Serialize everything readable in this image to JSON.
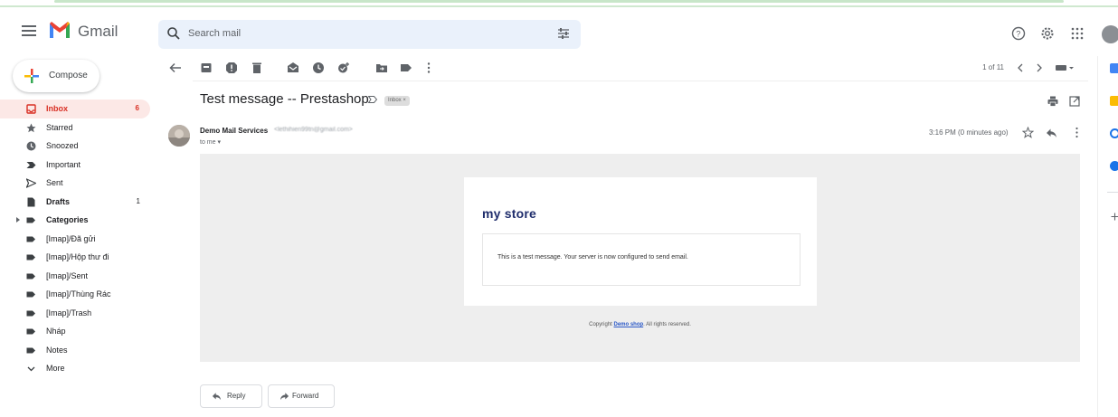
{
  "app": {
    "name": "Gmail"
  },
  "search": {
    "placeholder": "Search mail"
  },
  "compose": {
    "label": "Compose"
  },
  "sidebar": {
    "items": [
      {
        "label": "Inbox",
        "count": "6",
        "icon": "inbox-icon"
      },
      {
        "label": "Starred",
        "count": "",
        "icon": "star-icon"
      },
      {
        "label": "Snoozed",
        "count": "",
        "icon": "clock-icon"
      },
      {
        "label": "Important",
        "count": "",
        "icon": "important-icon"
      },
      {
        "label": "Sent",
        "count": "",
        "icon": "send-icon"
      },
      {
        "label": "Drafts",
        "count": "1",
        "icon": "draft-icon"
      },
      {
        "label": "Categories",
        "count": "",
        "icon": "label-icon"
      },
      {
        "label": "[Imap]/Đã gửi",
        "count": "",
        "icon": "label-icon"
      },
      {
        "label": "[Imap]/Hộp thư đi",
        "count": "",
        "icon": "label-icon"
      },
      {
        "label": "[Imap]/Sent",
        "count": "",
        "icon": "label-icon"
      },
      {
        "label": "[Imap]/Thùng Rác",
        "count": "",
        "icon": "label-icon"
      },
      {
        "label": "[Imap]/Trash",
        "count": "",
        "icon": "label-icon"
      },
      {
        "label": "Nháp",
        "count": "",
        "icon": "label-icon"
      },
      {
        "label": "Notes",
        "count": "",
        "icon": "label-icon"
      },
      {
        "label": "More",
        "count": "",
        "icon": "chevron-down-icon"
      }
    ]
  },
  "toolbar": {
    "pager": "1 of 11"
  },
  "message": {
    "subject": "Test message -- Prestashop",
    "label_chip": "Inbox ×",
    "sender_name": "Demo Mail Services",
    "sender_email": "<lethihien99tn@gmail.com>",
    "to": "to me ▾",
    "time": "3:16 PM (0 minutes ago)"
  },
  "email": {
    "store_logo": "my store",
    "body_text": "This is a test message. Your server is now configured to send email.",
    "copyright_prefix": "Copyright ",
    "copyright_link": "Demo shop",
    "copyright_suffix": ". All rights reserved."
  },
  "actions": {
    "reply": "Reply",
    "forward": "Forward"
  },
  "colors": {
    "accent_red": "#d93025",
    "inbox_bg": "#fce8e6",
    "search_bg": "#eaf1fb",
    "store_blue": "#1f2d6c"
  }
}
